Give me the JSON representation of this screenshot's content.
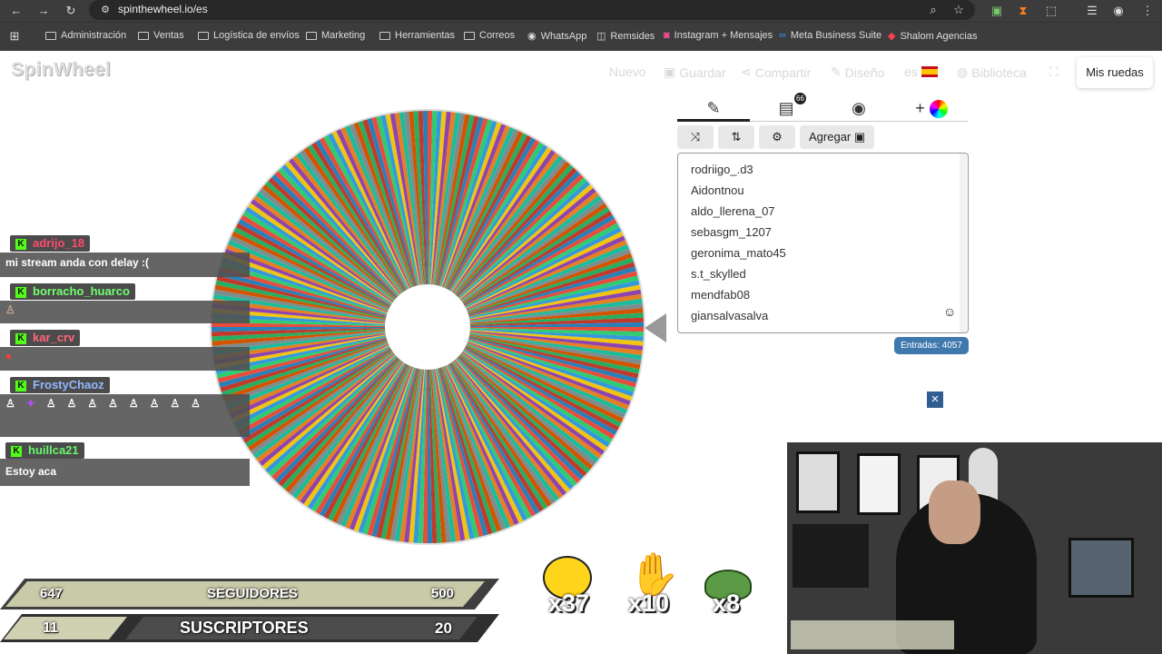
{
  "browser": {
    "url": "spinthewheel.io/es",
    "bookmarks": [
      "Administración",
      "Ventas",
      "Logística de envíos",
      "Marketing",
      "Herramientas",
      "Correos",
      "WhatsApp",
      "Remsides",
      "Instagram + Mensajes",
      "Meta Business Suite",
      "Shalom Agencias"
    ]
  },
  "site": {
    "logo": "SpinWheel",
    "nav": {
      "new": "Nuevo",
      "save": "Guardar",
      "share": "Compartir",
      "design": "Diseño",
      "language": "es",
      "library": "Biblioteca",
      "my_wheels": "Mis ruedas"
    },
    "panel": {
      "badge_count": "66",
      "add_label": "Agregar",
      "entries": [
        "rodriigo_.d3",
        "Aidontnou",
        "aldo_llerena_07",
        "sebasgm_1207",
        "geronima_mato45",
        "s.t_skylled",
        "mendfab08",
        "giansalvasalva"
      ],
      "entry_count": "Entradas: 4057"
    }
  },
  "chat": [
    {
      "name": "adrijo_18",
      "message": "mi stream anda con delay :(",
      "color": "#ff4a6e"
    },
    {
      "name": "borracho_huarco",
      "message": "",
      "color": "#73ff71"
    },
    {
      "name": "kar_crv",
      "message": "",
      "color": "#ff667a"
    },
    {
      "name": "FrostyChaoz",
      "message": "",
      "color": "#92b8ff"
    },
    {
      "name": "huillca21",
      "message": "Estoy aca",
      "color": "#68f56c"
    }
  ],
  "hud": {
    "followers_current": "647",
    "followers_label": "SEGUIDORES",
    "followers_goal": "500",
    "subs_current": "11",
    "subs_label": "SUSCRIPTORES",
    "subs_goal": "20",
    "rewards": [
      "x37",
      "x10",
      "x8"
    ]
  },
  "colors": {
    "accent": "#3f78ad",
    "chat_bg": "#505050",
    "hud_primary": "#c9caa8",
    "hud_secondary": "#4c4c4c"
  }
}
